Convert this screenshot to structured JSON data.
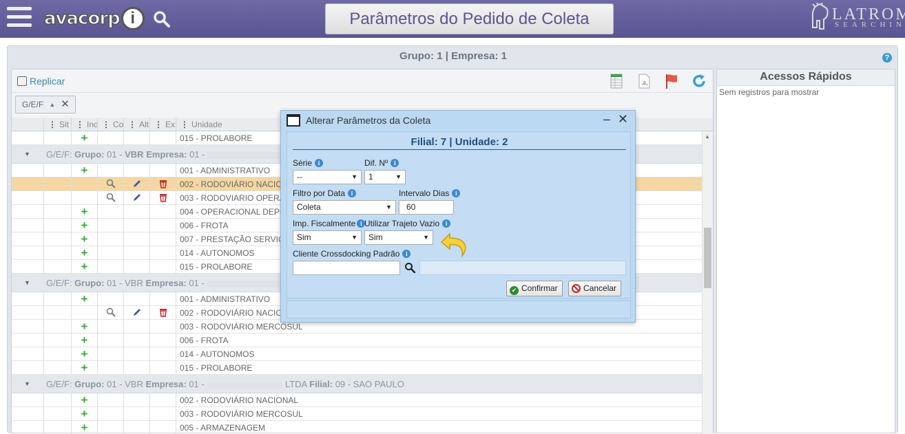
{
  "header": {
    "logo_text": "avacorp",
    "logo_info_glyph": "i",
    "page_title": "Parâmetros do Pedido de Coleta",
    "brand_name": "LATROM",
    "brand_sub": "SEARCHIN"
  },
  "main": {
    "group_title": "Grupo: 1 | Empresa: 1",
    "help_glyph": "?"
  },
  "toolbar": {
    "replicar_label": "Replicar"
  },
  "groupby": {
    "chip_label": "G/E/F",
    "chip_sort": "▲",
    "chip_close": "✕"
  },
  "columns": [
    "Sit",
    "Ind",
    "Co",
    "Alt",
    "Ex",
    "Unidade"
  ],
  "rows_a": [
    {
      "unit": "015 - PROLABORE"
    }
  ],
  "group1": {
    "prefix": "G/E/F: ",
    "b1": "Grupo:",
    "t1": " 01 - ",
    "b2": "VBR",
    "t2": " ",
    "b3": "Empresa:",
    "t3": " 01 - ",
    "tail": ""
  },
  "rows_g1": [
    {
      "unit": "001 - ADMINISTRATIVO"
    },
    {
      "unit": "002 - RODOVIÁRIO NACIO"
    },
    {
      "unit": "003 - RODOVIARIO OPERA"
    },
    {
      "unit": "004 - OPERACIONAL DEPO"
    },
    {
      "unit": "006 - FROTA"
    },
    {
      "unit": "007 - PRESTAÇÃO SERVIÇ"
    },
    {
      "unit": "014 - AUTONOMOS"
    },
    {
      "unit": "015 - PROLABORE"
    }
  ],
  "group2": {
    "prefix": "G/E/F: ",
    "b1": "Grupo:",
    "t1": " 01 - VBR ",
    "b3": "Empresa:",
    "t3": " 01 - "
  },
  "rows_g2": [
    {
      "unit": "001 - ADMINISTRATIVO"
    },
    {
      "unit": "002 - RODOVIÁRIO NACIO"
    },
    {
      "unit": "003 - RODOVIÁRIO MERCOSUL"
    },
    {
      "unit": "006 - FROTA"
    },
    {
      "unit": "014 - AUTONOMOS"
    },
    {
      "unit": "015 - PROLABORE"
    }
  ],
  "group3": {
    "prefix": "G/E/F: ",
    "b1": "Grupo:",
    "t1": " 01 - VBR ",
    "b3": "Empresa:",
    "t3": " 01 - ",
    "t4": " LTDA ",
    "b4": "Filial:",
    "t5": " 09 - SAO PAULO"
  },
  "rows_g3": [
    {
      "unit": "002 - RODOVIÁRIO NACIONAL"
    },
    {
      "unit": "003 - RODOVIÁRIO MERCOSUL"
    },
    {
      "unit": "005 - ARMAZENAGEM"
    }
  ],
  "quick_access": {
    "title": "Acessos Rápidos",
    "empty_text": "Sem registros para mostrar"
  },
  "dialog": {
    "title": "Alterar Parâmetros da Coleta",
    "minimize": "–",
    "close": "✕",
    "subtitle": "Filial: 7 | Unidade: 2",
    "info_glyph": "i",
    "serie_label": "Série",
    "serie_value": "--",
    "dif_label": "Dif. Nº",
    "dif_value": "1",
    "filtro_label": "Filtro por Data",
    "filtro_value": "Coleta",
    "intervalo_label": "Intervalo Dias",
    "intervalo_value": "60",
    "imp_label": "Imp. Fiscalmente",
    "imp_value": "Sim",
    "trajeto_label": "Utilizar Trajeto Vazio",
    "trajeto_value": "Sim",
    "cliente_label": "Cliente Crossdocking Padrão",
    "cliente_value": "",
    "cliente_desc": "",
    "confirm_label": "Confirmar",
    "cancel_label": "Cancelar",
    "dropdown_arrow": "▼"
  }
}
